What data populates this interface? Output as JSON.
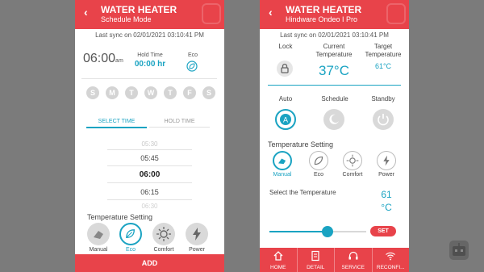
{
  "schedule": {
    "header": {
      "title": "WATER HEATER",
      "subtitle": "Schedule Mode"
    },
    "last_sync": "Last sync on 02/01/2021 03:10:41 PM",
    "time": {
      "value": "06:00",
      "suffix": "am"
    },
    "hold_time": {
      "label": "Hold Time",
      "value": "00:00 hr"
    },
    "eco": {
      "label": "Eco"
    },
    "days": [
      "S",
      "M",
      "T",
      "W",
      "T",
      "F",
      "S"
    ],
    "tabs": {
      "select_time": "SELECT TIME",
      "hold_time": "HOLD TIME"
    },
    "time_picker": [
      "05:30",
      "05:45",
      "06:00",
      "06:15",
      "06:30"
    ],
    "temp_setting_label": "Temperature Setting",
    "modes": [
      {
        "label": "Manual",
        "icon": "manual-icon",
        "selected": false
      },
      {
        "label": "Eco",
        "icon": "leaf-icon",
        "selected": true
      },
      {
        "label": "Comfort",
        "icon": "sun-icon",
        "selected": false
      },
      {
        "label": "Power",
        "icon": "bolt-icon",
        "selected": false
      }
    ],
    "add_button": "ADD"
  },
  "detail": {
    "header": {
      "title": "WATER HEATER",
      "subtitle": "Hindware Ondeo I Pro"
    },
    "last_sync": "Last sync on 02/01/2021 03:10:41 PM",
    "lock": {
      "label": "Lock"
    },
    "current_temp": {
      "label_line1": "Current",
      "label_line2": "Temperature",
      "value": "37°C"
    },
    "target_temp": {
      "label_line1": "Target",
      "label_line2": "Temperature",
      "value": "61°C"
    },
    "operation_modes": [
      {
        "label": "Auto",
        "icon": "auto-icon",
        "selected": true
      },
      {
        "label": "Schedule",
        "icon": "moon-icon",
        "selected": false
      },
      {
        "label": "Standby",
        "icon": "power-icon",
        "selected": false
      }
    ],
    "temp_setting_label": "Temperature Setting",
    "modes": [
      {
        "label": "Manual",
        "icon": "manual-icon",
        "selected": true
      },
      {
        "label": "Eco",
        "icon": "leaf-icon",
        "selected": false
      },
      {
        "label": "Comfort",
        "icon": "sun-icon",
        "selected": false
      },
      {
        "label": "Power",
        "icon": "bolt-icon",
        "selected": false
      }
    ],
    "select_temp_label": "Select the Temperature",
    "select_temp_value": "61",
    "select_temp_unit": "°C",
    "slider_fraction": 0.6,
    "set_button": "SET",
    "nav": [
      {
        "label": "HOME",
        "icon": "home-icon"
      },
      {
        "label": "DETAIL",
        "icon": "document-icon"
      },
      {
        "label": "SERVICE",
        "icon": "headset-icon"
      },
      {
        "label": "RECONFI...",
        "icon": "wifi-icon"
      }
    ]
  },
  "colors": {
    "accent_red": "#e8434a",
    "accent_blue": "#1aa3c2",
    "background": "#7b7b7b"
  }
}
